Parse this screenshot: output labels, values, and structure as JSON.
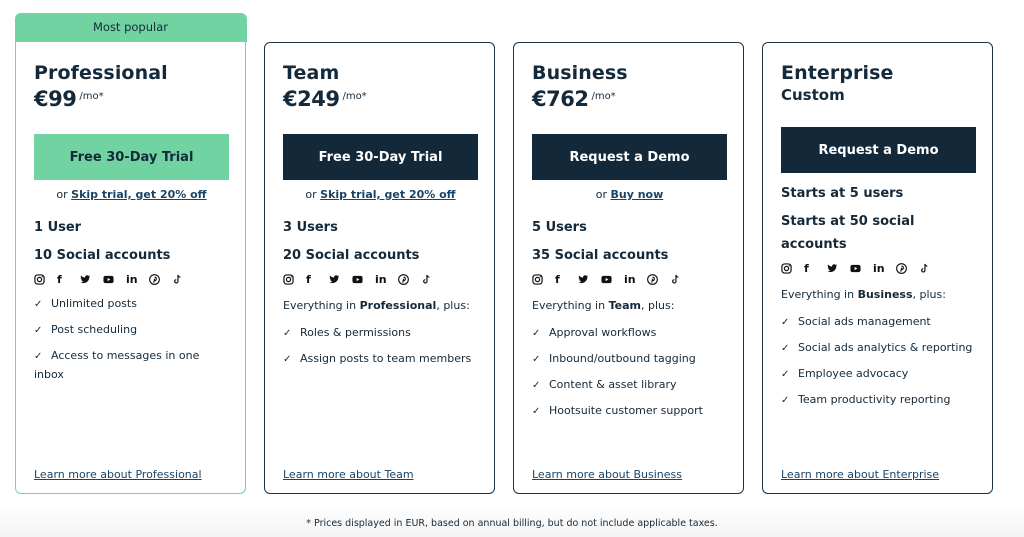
{
  "plans": [
    {
      "banner": "Most popular",
      "name": "Professional",
      "price": "€99",
      "per": "/mo*",
      "cta": "Free 30-Day Trial",
      "alt_prefix": "or ",
      "alt_link": "Skip trial, get 20% off",
      "users": "1 User",
      "accounts": "10 Social accounts",
      "everything_prefix": "",
      "everything_bold": "",
      "everything_suffix": "",
      "features": [
        "Unlimited posts",
        "Post scheduling",
        "Access to messages in one inbox"
      ],
      "learn_more": "Learn more about Professional"
    },
    {
      "name": "Team",
      "price": "€249",
      "per": "/mo*",
      "cta": "Free 30-Day Trial",
      "alt_prefix": "or ",
      "alt_link": "Skip trial, get 20% off",
      "users": "3 Users",
      "accounts": "20 Social accounts",
      "everything_prefix": "Everything in ",
      "everything_bold": "Professional",
      "everything_suffix": ", plus:",
      "features": [
        "Roles & permissions",
        "Assign posts to team members"
      ],
      "learn_more": "Learn more about Team"
    },
    {
      "name": "Business",
      "price": "€762",
      "per": "/mo*",
      "cta": "Request a Demo",
      "alt_prefix": "or ",
      "alt_link": "Buy now",
      "users": "5 Users",
      "accounts": "35 Social accounts",
      "everything_prefix": "Everything in ",
      "everything_bold": "Team",
      "everything_suffix": ", plus:",
      "features": [
        "Approval workflows",
        "Inbound/outbound tagging",
        "Content & asset library",
        "Hootsuite customer support"
      ],
      "learn_more": "Learn more about Business"
    },
    {
      "name": "Enterprise",
      "custom": "Custom",
      "cta": "Request a Demo",
      "users": "Starts at 5 users",
      "accounts": "Starts at 50 social accounts",
      "everything_prefix": "Everything in ",
      "everything_bold": "Business",
      "everything_suffix": ", plus:",
      "features": [
        "Social ads management",
        "Social ads analytics & reporting",
        "Employee advocacy",
        "Team productivity reporting"
      ],
      "learn_more": "Learn more about Enterprise"
    }
  ],
  "social_icons": [
    "instagram-icon",
    "facebook-icon",
    "twitter-icon",
    "youtube-icon",
    "linkedin-icon",
    "pinterest-icon",
    "tiktok-icon"
  ],
  "check_glyph": "✓",
  "footnote": "* Prices displayed in EUR, based on annual billing, but do not include applicable taxes.",
  "colors": {
    "accent_green": "#72d3a2",
    "dark_navy": "#13293a",
    "link_blue": "#1a4466"
  }
}
